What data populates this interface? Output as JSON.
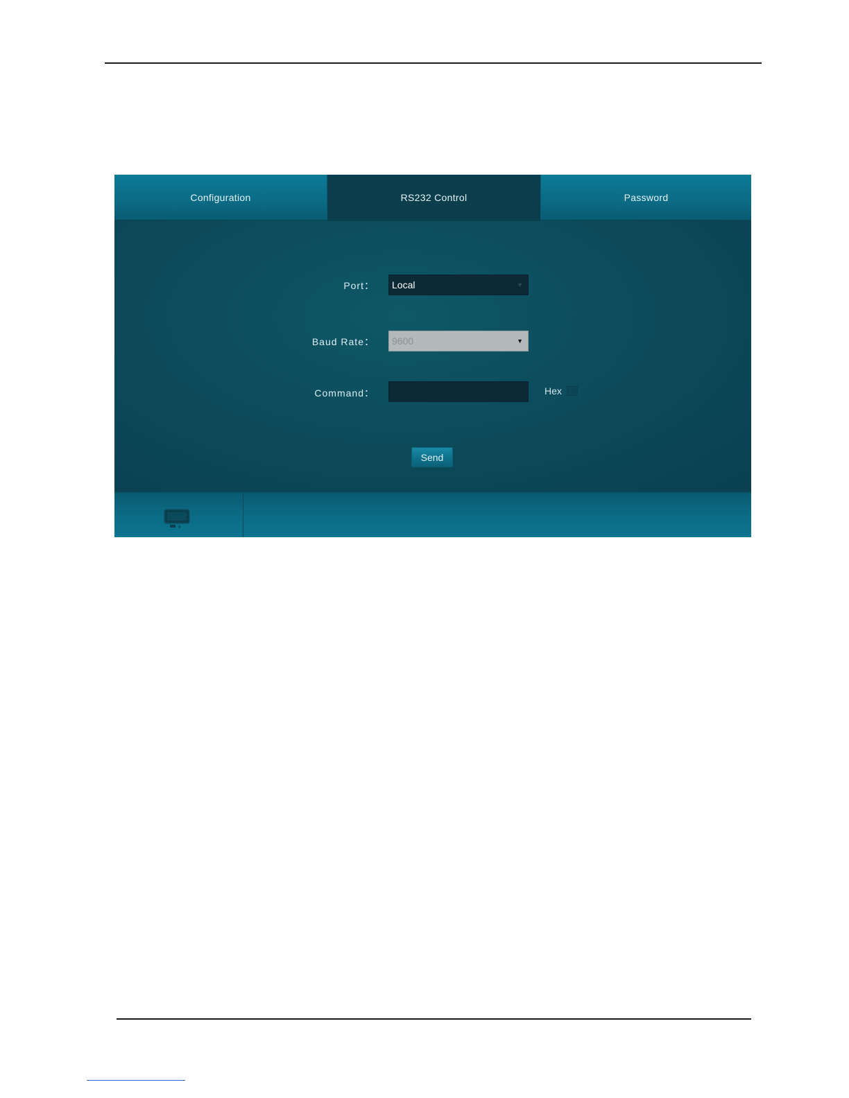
{
  "tabs": {
    "configuration": "Configuration",
    "rs232_control": "RS232 Control",
    "password": "Password",
    "active": "rs232_control"
  },
  "form": {
    "port_label": "Port：",
    "port_value": "Local",
    "baud_label": "Baud Rate：",
    "baud_value": "9600",
    "command_label": "Command：",
    "command_value": "",
    "hex_label": "Hex",
    "send_label": "Send"
  },
  "icons": {
    "select_caret": "▼",
    "footer_icon": "display-icon"
  },
  "colors": {
    "panel_bg": "#0d4a5a",
    "tab_bg": "#0b6c86",
    "active_tab_bg": "#0a3e4c",
    "accent": "#0e6f89"
  }
}
